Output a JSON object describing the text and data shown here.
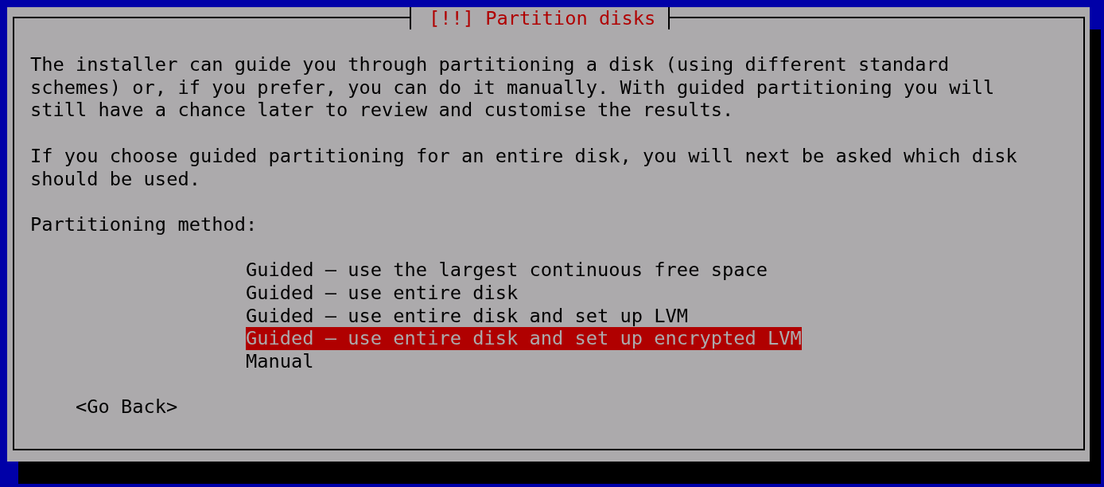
{
  "dialog": {
    "title": "[!!] Partition disks",
    "paragraphs": [
      "The installer can guide you through partitioning a disk (using different standard schemes) or, if you prefer, you can do it manually. With guided partitioning you will still have a chance later to review and customise the results.",
      "If you choose guided partitioning for an entire disk, you will next be asked which disk should be used."
    ],
    "prompt": "Partitioning method:",
    "options": [
      {
        "label": "Guided – use the largest continuous free space",
        "selected": false
      },
      {
        "label": "Guided – use entire disk",
        "selected": false
      },
      {
        "label": "Guided – use entire disk and set up LVM",
        "selected": false
      },
      {
        "label": "Guided – use entire disk and set up encrypted LVM",
        "selected": true
      },
      {
        "label": "Manual",
        "selected": false
      }
    ],
    "back_button": {
      "label": "<Go Back>"
    }
  }
}
